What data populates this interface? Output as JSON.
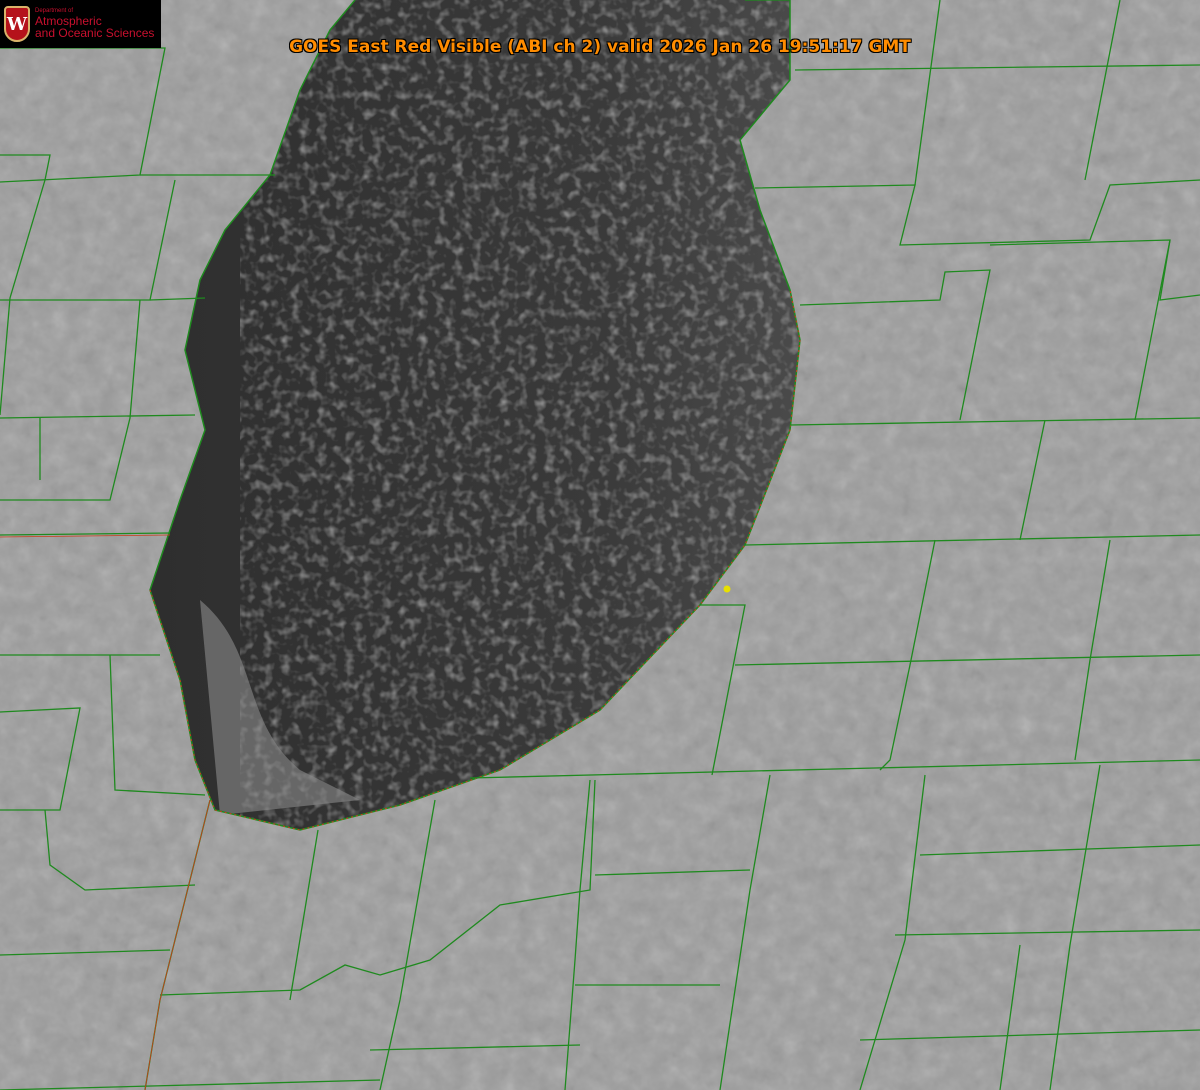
{
  "title": "GOES East Red Visible (ABI ch 2) valid 2026 Jan 26 19:51:17 GMT",
  "logo": {
    "department_of": "Department of",
    "line1": "Atmospheric",
    "line2": "and Oceanic Sciences",
    "crest_letter": "W"
  },
  "colors": {
    "border": "#1f8a1f",
    "state_line": "#cc3b1b",
    "title": "#ff8c00",
    "marker": "#e8e000"
  }
}
